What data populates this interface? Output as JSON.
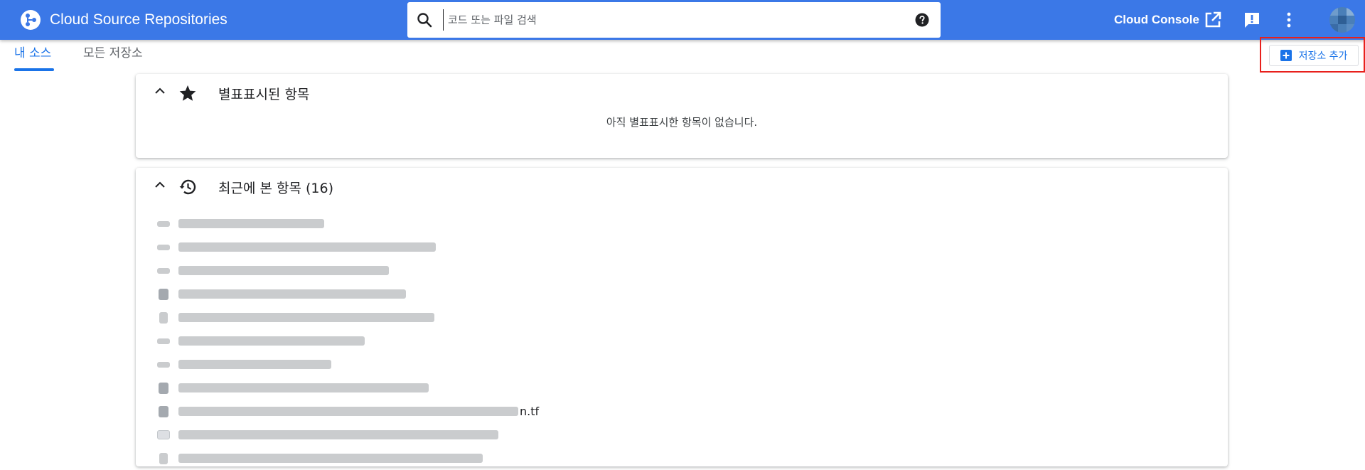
{
  "header": {
    "app_title": "Cloud Source Repositories",
    "search_placeholder": "코드 또는 파일 검색",
    "console_link": "Cloud Console",
    "icons": [
      "logo-icon",
      "search-icon",
      "help-icon",
      "open-in-new-icon",
      "feedback-icon",
      "more-vert-icon",
      "avatar"
    ]
  },
  "tabs": [
    {
      "label": "내 소스",
      "active": true
    },
    {
      "label": "모든 저장소",
      "active": false
    }
  ],
  "actions": {
    "add_repo": "저장소 추가"
  },
  "starred": {
    "title": "별표표시된 항목",
    "empty_message": "아직 별표표시한 항목이 없습니다."
  },
  "recent": {
    "title": "최근에 본 항목 (16)",
    "items": [
      {
        "icon": "repo-icon",
        "suffix": ""
      },
      {
        "icon": "repo-icon",
        "suffix": ""
      },
      {
        "icon": "repo-icon",
        "suffix": ""
      },
      {
        "icon": "file-icon",
        "suffix": ""
      },
      {
        "icon": "branch-icon",
        "suffix": ""
      },
      {
        "icon": "repo-icon",
        "suffix": ""
      },
      {
        "icon": "repo-icon",
        "suffix": ""
      },
      {
        "icon": "file-icon",
        "suffix": ""
      },
      {
        "icon": "file-icon",
        "suffix": "n.tf"
      },
      {
        "icon": "folder-icon",
        "suffix": ""
      },
      {
        "icon": "branch-icon",
        "suffix": ""
      }
    ]
  },
  "colors": {
    "appbar": "#3b78e7",
    "accent": "#1a73e8",
    "highlight": "#e8201c"
  }
}
